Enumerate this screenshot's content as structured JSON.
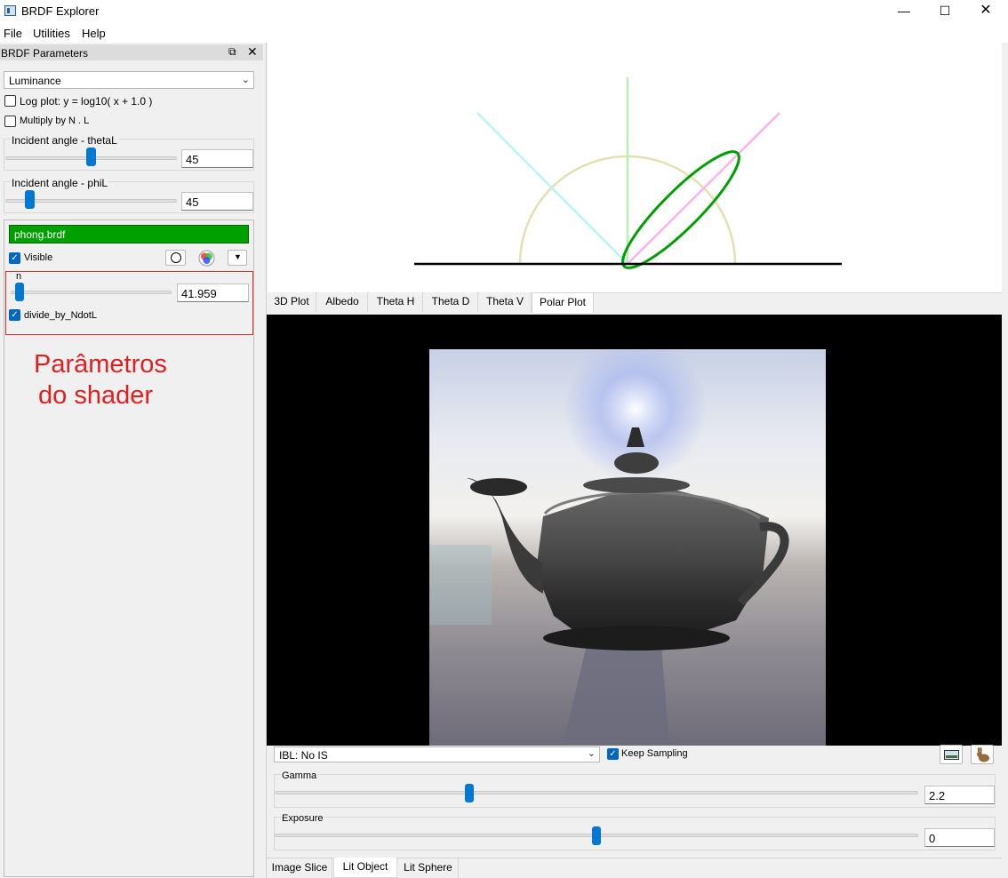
{
  "window": {
    "title": "BRDF Explorer",
    "min_icon": "minimize-icon",
    "max_icon": "maximize-icon",
    "close_icon": "close-icon"
  },
  "menu": {
    "file": "File",
    "utilities": "Utilities",
    "help": "Help"
  },
  "dock": {
    "title": "BRDF Parameters",
    "channel_select": "Luminance",
    "log_plot_label": "Log plot:  y = log10( x + 1.0 )",
    "log_plot_checked": false,
    "multiply_label": "Multiply by N . L",
    "multiply_checked": false,
    "theta_label": "Incident angle - thetaL",
    "theta_value": "45",
    "phi_label": "Incident angle - phiL",
    "phi_value": "45",
    "brdf_name": "phong.brdf",
    "brdf_color": "#00a000",
    "visible_label": "Visible",
    "visible_checked": true,
    "param_n_label": "n",
    "param_n_value": "41.959",
    "divide_label": "divide_by_NdotL",
    "divide_checked": true,
    "annotation_line1": "Parâmetros",
    "annotation_line2": "do shader",
    "annotation_color": "#e02020"
  },
  "plot_tabs": [
    "3D Plot",
    "Albedo",
    "Theta H",
    "Theta D",
    "Theta V",
    "Polar Plot"
  ],
  "plot_tab_selected": "Polar Plot",
  "lit": {
    "ibl_select": "IBL: No IS",
    "keep_sampling_label": "Keep Sampling",
    "keep_sampling_checked": true,
    "gamma_label": "Gamma",
    "gamma_value": "2.2",
    "exposure_label": "Exposure",
    "exposure_value": "0"
  },
  "bottom_tabs": [
    "Image Slice",
    "Lit Object",
    "Lit Sphere"
  ],
  "bottom_tab_selected": "Lit Object"
}
